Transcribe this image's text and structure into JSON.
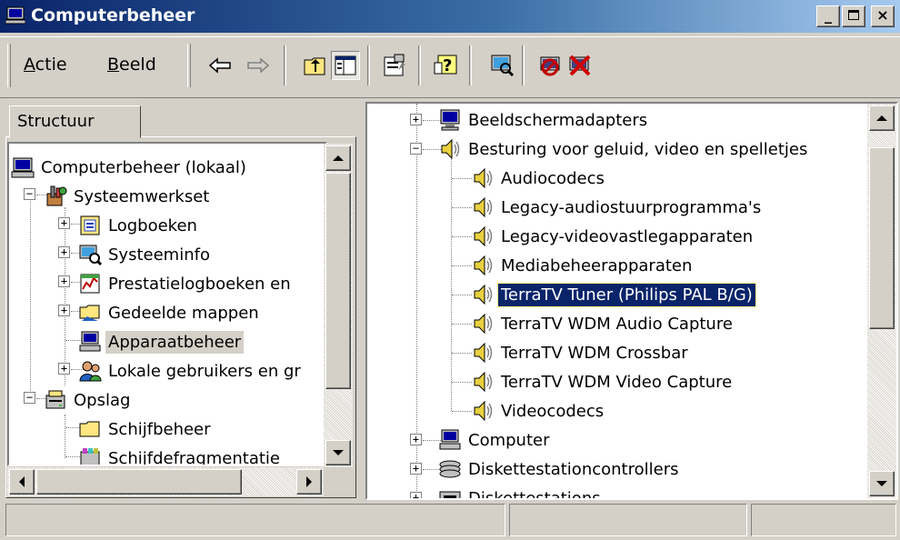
{
  "window": {
    "title": "Computerbeheer",
    "minimize_icon": "minimize-icon",
    "maximize_icon": "maximize-icon",
    "close_icon": "close-icon"
  },
  "toolbar": {
    "menus": [
      {
        "label_first": "A",
        "label_rest": "ctie"
      },
      {
        "label_first": "B",
        "label_rest": "eeld"
      }
    ],
    "buttons": [
      "back-arrow-icon",
      "forward-arrow-icon",
      "up-folder-icon",
      "show-hide-tree-icon",
      "properties-icon",
      "help-icon",
      "scan-hardware-icon",
      "disable-device-icon",
      "uninstall-device-icon"
    ]
  },
  "left": {
    "tab_label": "Structuur",
    "items": [
      {
        "label": "Computerbeheer (lokaal)"
      },
      {
        "label": "Systeemwerkset"
      },
      {
        "label": "Logboeken"
      },
      {
        "label": "Systeeminfo"
      },
      {
        "label": "Prestatielogboeken en"
      },
      {
        "label": "Gedeelde mappen"
      },
      {
        "label": "Apparaatbeheer"
      },
      {
        "label": "Lokale gebruikers en gr"
      },
      {
        "label": "Opslag"
      },
      {
        "label": "Schijfbeheer"
      },
      {
        "label": "Schijfdefragmentatie"
      }
    ]
  },
  "right": {
    "items": [
      {
        "label": "Beeldschermadapters"
      },
      {
        "label": "Besturing voor geluid, video en spelletjes"
      },
      {
        "label": "Audiocodecs"
      },
      {
        "label": "Legacy-audiostuurprogramma's"
      },
      {
        "label": "Legacy-videovastlegapparaten"
      },
      {
        "label": "Mediabeheerapparaten"
      },
      {
        "label": "TerraTV Tuner (Philips PAL B/G)"
      },
      {
        "label": "TerraTV WDM Audio Capture"
      },
      {
        "label": "TerraTV WDM Crossbar"
      },
      {
        "label": "TerraTV WDM Video Capture"
      },
      {
        "label": "Videocodecs"
      },
      {
        "label": "Computer"
      },
      {
        "label": "Diskettestationcontrollers"
      },
      {
        "label": "Diskettestations"
      }
    ]
  },
  "colors": {
    "title_start": "#0a246a",
    "title_end": "#a6caf0",
    "selection": "#0a246a",
    "face": "#d4d0c8"
  }
}
